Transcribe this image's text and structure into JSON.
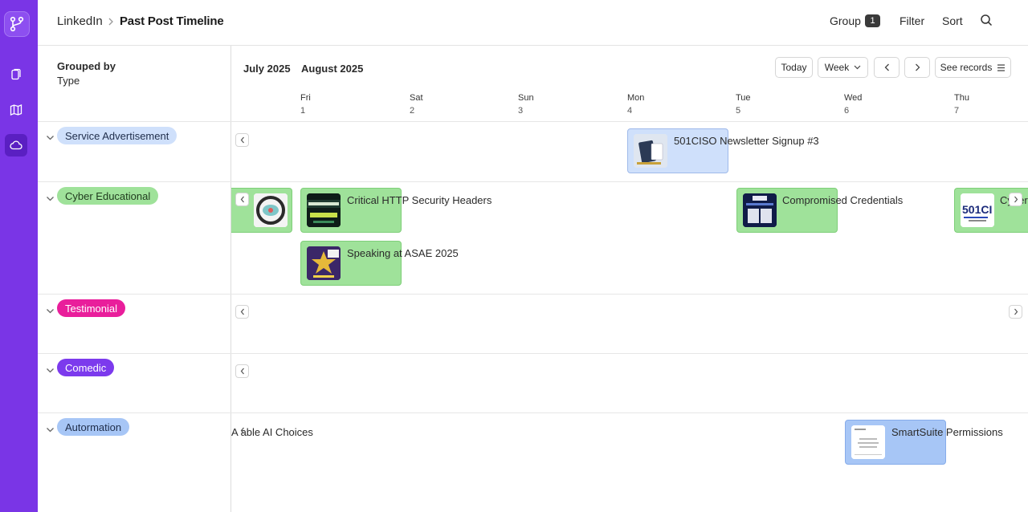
{
  "app": {
    "name": "LinkedIn",
    "page_title": "Past Post Timeline"
  },
  "header": {
    "group_label": "Group",
    "group_count": "1",
    "filter_label": "Filter",
    "sort_label": "Sort"
  },
  "group_panel": {
    "grouped_by_label": "Grouped by",
    "grouped_by_value": "Type"
  },
  "timeline": {
    "months": [
      "July 2025",
      "August 2025"
    ],
    "today_label": "Today",
    "view_label": "Week",
    "see_records_label": "See records",
    "days": [
      {
        "name": "Fri",
        "num": "1"
      },
      {
        "name": "Sat",
        "num": "2"
      },
      {
        "name": "Sun",
        "num": "3"
      },
      {
        "name": "Mon",
        "num": "4"
      },
      {
        "name": "Tue",
        "num": "5"
      },
      {
        "name": "Wed",
        "num": "6"
      },
      {
        "name": "Thu",
        "num": "7"
      }
    ]
  },
  "groups": [
    {
      "label": "Service Advertisement",
      "color": "#cfe0fb"
    },
    {
      "label": "Cyber Educational",
      "color": "#9fe29a"
    },
    {
      "label": "Testimonial",
      "color": "#e91e9b"
    },
    {
      "label": "Comedic",
      "color": "#7c3aed"
    },
    {
      "label": "Autormation",
      "color": "#a7c6f6"
    }
  ],
  "records": {
    "newsletter": "501CISO Newsletter Signup #3",
    "headers": "Critical HTTP Security Headers",
    "speaking": "Speaking at ASAE 2025",
    "credentials": "Compromised Credentials",
    "cyber": "Cyber",
    "ai_choices": "A  able AI Choices",
    "permissions": "SmartSuite Permissions"
  }
}
